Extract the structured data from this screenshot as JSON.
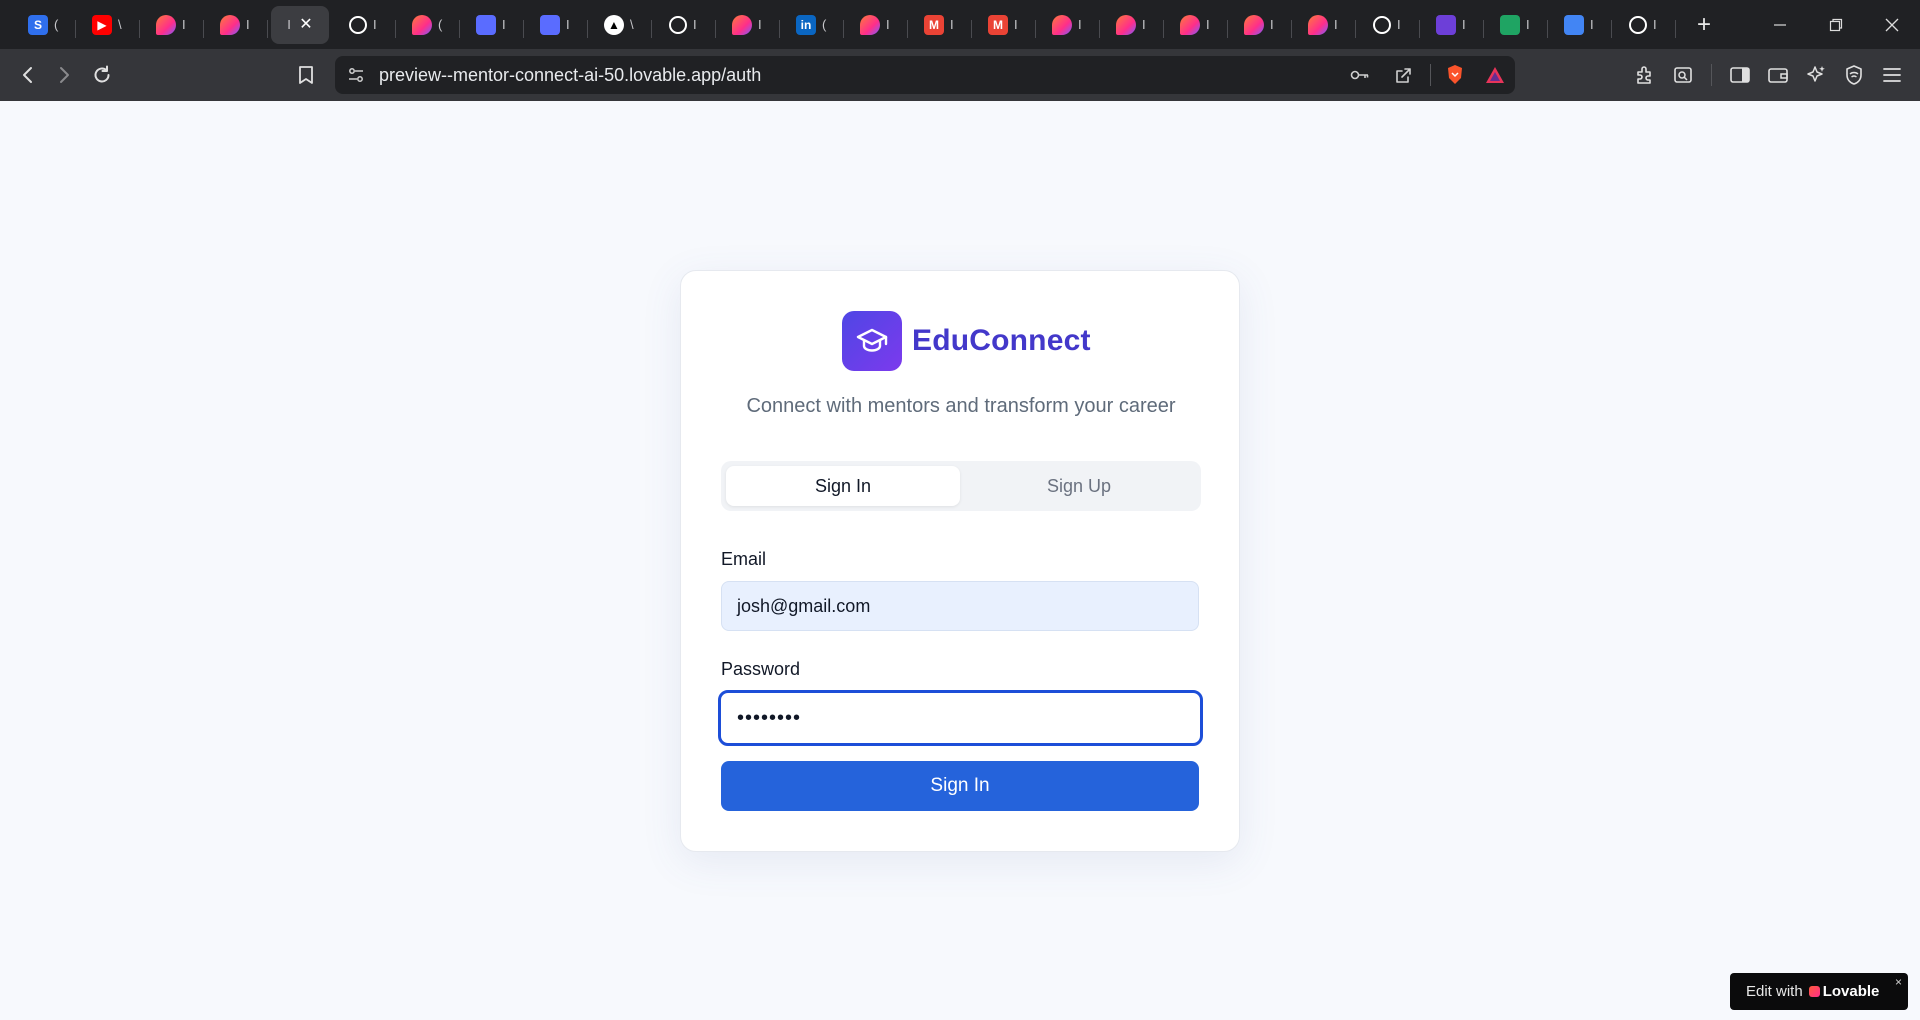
{
  "browser": {
    "tabs": [
      {
        "icon": "s-app-icon",
        "glyph": "S",
        "color": "#2f6fed",
        "frag": "("
      },
      {
        "icon": "youtube-icon",
        "glyph": "▶",
        "color": "#ff0000",
        "frag": "\\"
      },
      {
        "icon": "lovable-icon",
        "glyph": "",
        "color": "#ff5a5f",
        "frag": "I"
      },
      {
        "icon": "lovable-icon",
        "glyph": "",
        "color": "#ff5a5f",
        "frag": "I"
      },
      {
        "icon": "",
        "glyph": "",
        "color": "",
        "frag": "I",
        "active": true
      },
      {
        "icon": "github-icon",
        "glyph": "",
        "color": "#ffffff",
        "frag": "I"
      },
      {
        "icon": "lovable-icon",
        "glyph": "",
        "color": "#ff5a5f",
        "frag": "("
      },
      {
        "icon": "windsurf-icon",
        "glyph": "",
        "color": "#5a6cff",
        "frag": "I"
      },
      {
        "icon": "windsurf-icon",
        "glyph": "",
        "color": "#5a6cff",
        "frag": "I"
      },
      {
        "icon": "vercel-icon",
        "glyph": "▲",
        "color": "#000000",
        "frag": "\\"
      },
      {
        "icon": "github-icon",
        "glyph": "",
        "color": "#ffffff",
        "frag": "I"
      },
      {
        "icon": "lovable-icon",
        "glyph": "",
        "color": "#ff5a5f",
        "frag": "I"
      },
      {
        "icon": "linkedin-icon",
        "glyph": "in",
        "color": "#0a66c2",
        "frag": "("
      },
      {
        "icon": "lovable-icon",
        "glyph": "",
        "color": "#ff5a5f",
        "frag": "I"
      },
      {
        "icon": "gmail-icon",
        "glyph": "M",
        "color": "#ea4335",
        "frag": "I"
      },
      {
        "icon": "gmail-icon",
        "glyph": "M",
        "color": "#ea4335",
        "frag": "I"
      },
      {
        "icon": "lovable-icon",
        "glyph": "",
        "color": "#ff5a5f",
        "frag": "I"
      },
      {
        "icon": "lovable-icon",
        "glyph": "",
        "color": "#ff5a5f",
        "frag": "I"
      },
      {
        "icon": "lovable-icon",
        "glyph": "",
        "color": "#ff5a5f",
        "frag": "I"
      },
      {
        "icon": "lovable-icon",
        "glyph": "",
        "color": "#ff5a5f",
        "frag": "I"
      },
      {
        "icon": "lovable-icon",
        "glyph": "",
        "color": "#ff5a5f",
        "frag": "I"
      },
      {
        "icon": "openai-icon",
        "glyph": "",
        "color": "#ffffff",
        "frag": "I"
      },
      {
        "icon": "list-app-icon",
        "glyph": "",
        "color": "#6d3fd8",
        "frag": "I"
      },
      {
        "icon": "google-drive-icon",
        "glyph": "",
        "color": "#1fa463",
        "frag": "I"
      },
      {
        "icon": "google-docs-icon",
        "glyph": "",
        "color": "#4285f4",
        "frag": "I"
      },
      {
        "icon": "github-icon",
        "glyph": "",
        "color": "#ffffff",
        "frag": "I"
      }
    ],
    "new_tab": "+",
    "url": "preview--mentor-connect-ai-50.lovable.app/auth"
  },
  "page": {
    "brand_name": "EduConnect",
    "tagline": "Connect with mentors and transform your career",
    "tabs": {
      "sign_in": "Sign In",
      "sign_up": "Sign Up",
      "active": "sign_in"
    },
    "email_label": "Email",
    "email_value": "josh@gmail.com",
    "password_label": "Password",
    "password_value": "••••••••",
    "submit_label": "Sign In"
  },
  "badge": {
    "prefix": "Edit with",
    "brand": "Lovable",
    "close": "×"
  },
  "colors": {
    "brand": "#4338ca",
    "primary_button": "#2563db",
    "focus_border": "#1d4ed8",
    "autofill_bg": "#e8f0fe",
    "page_bg": "#f7f9fd"
  }
}
